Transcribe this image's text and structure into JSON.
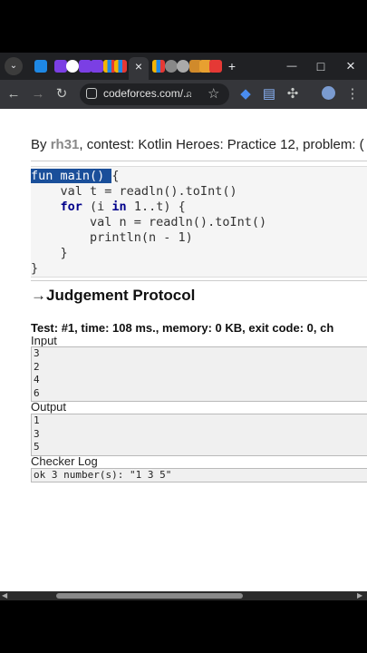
{
  "browser": {
    "tab_glyph_close": "×",
    "new_tab_glyph": "+",
    "window_minimize": "—",
    "window_maximize": "□",
    "window_close": "×",
    "url": "codeforces.com/...",
    "colors": {
      "tabstrip": "#202124",
      "toolbar": "#35363a"
    }
  },
  "page": {
    "byline_prefix": "By ",
    "byline_user": "rh31",
    "byline_rest": ", contest: Kotlin Heroes: Practice 12, problem: (",
    "code": {
      "line1_selected": "fun main() ",
      "line1_rest": "{",
      "line2": "    val t = readln().toInt()",
      "line3_kw1": "for",
      "line3_a": " (i ",
      "line3_kw2": "in",
      "line3_b": " 1..t) {",
      "line4": "        val n = readln().toInt()",
      "line5": "        println(n - 1)",
      "line6": "    }",
      "line7": "}"
    },
    "judgement_arrow": "→",
    "judgement_title": "Judgement Protocol",
    "test_line": "Test: #1, time: 108 ms., memory: 0 KB, exit code: 0, ch",
    "input_label": "Input",
    "input_lines": [
      "3",
      "2",
      "4",
      "6"
    ],
    "output_label": "Output",
    "output_lines": [
      "1",
      "3",
      "5"
    ],
    "checker_label": "Checker Log",
    "checker_log": "ok 3 number(s): \"1 3 5\""
  }
}
